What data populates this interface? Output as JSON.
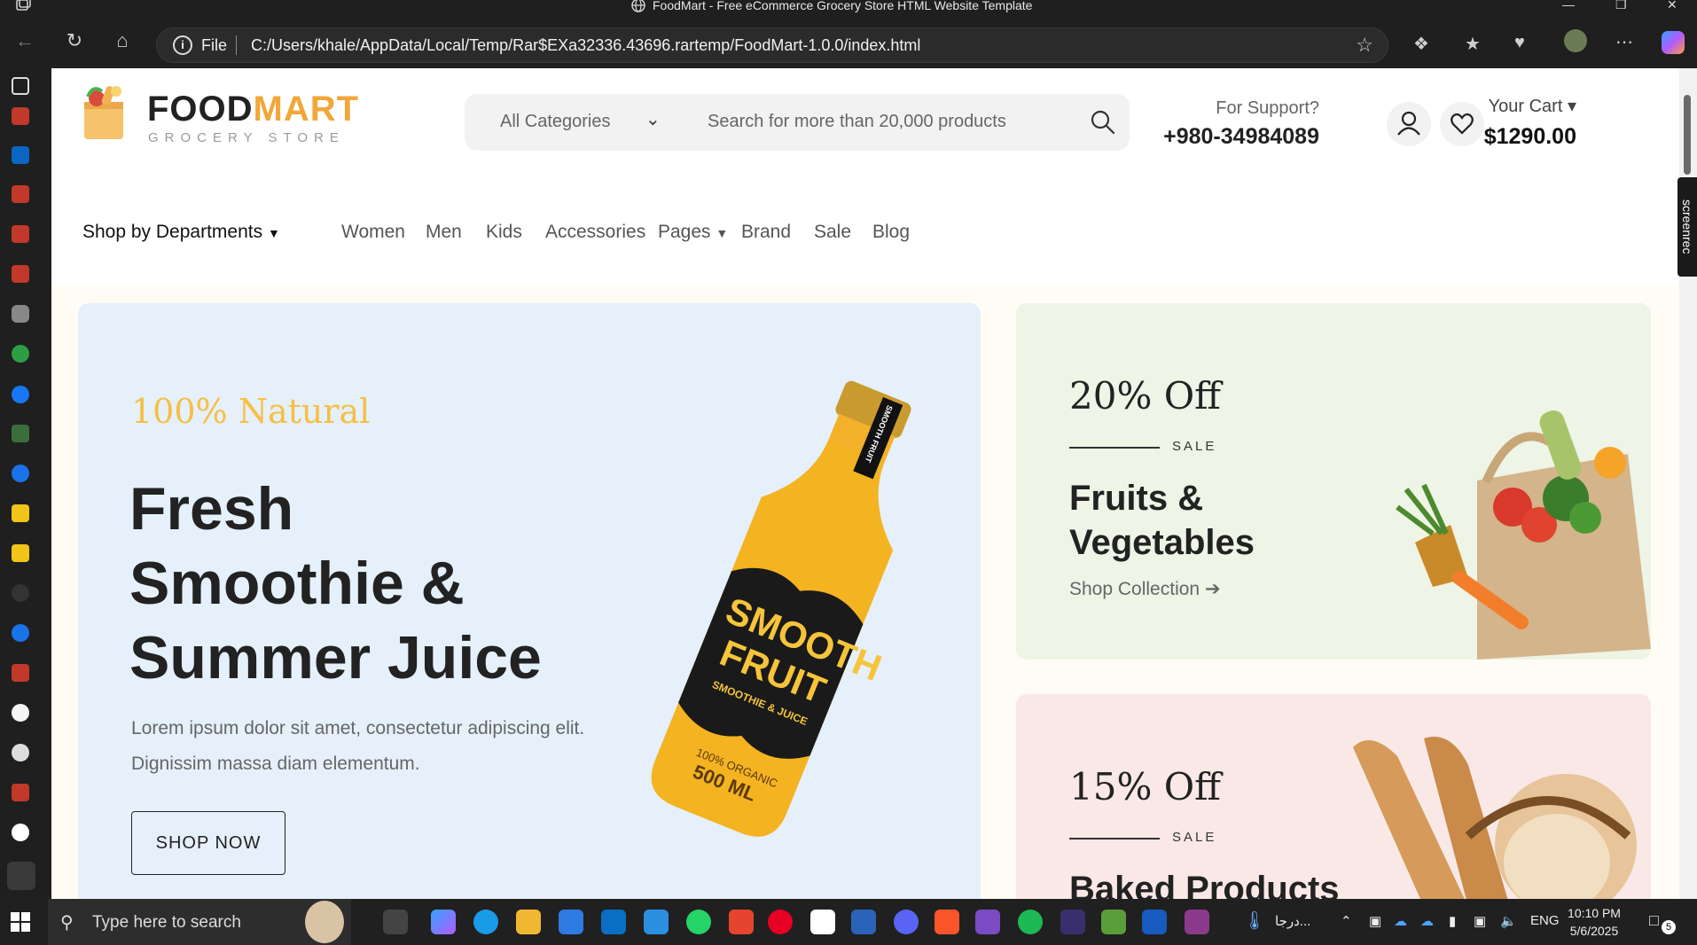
{
  "window": {
    "title": "FoodMart - Free eCommerce Grocery Store HTML Website Template"
  },
  "addressbar": {
    "scheme_label": "File",
    "url": "C:/Users/khale/AppData/Local/Temp/Rar$EXa32336.43696.rartemp/FoodMart-1.0.0/index.html"
  },
  "header": {
    "brand_part1": "FOOD",
    "brand_part2": "MART",
    "tagline": "GROCERY STORE",
    "category_select": "All Categories",
    "search_placeholder": "Search for more than 20,000 products",
    "support_label": "For Support?",
    "support_phone": "+980-34984089",
    "cart_label": "Your Cart",
    "cart_total": "$1290.00"
  },
  "nav": {
    "departments": "Shop by Departments",
    "items": [
      "Women",
      "Men",
      "Kids",
      "Accessories",
      "Pages",
      "Brand",
      "Sale",
      "Blog"
    ]
  },
  "banner": {
    "kicker": "100% Natural",
    "headline_line1": "Fresh",
    "headline_line2": "Smoothie &",
    "headline_line3": "Summer Juice",
    "description": "Lorem ipsum dolor sit amet, consectetur adipiscing elit. Dignissim massa diam elementum.",
    "button": "SHOP NOW",
    "bottle_label_top": "SMOOTH FRUIT",
    "bottle_label_main1": "SMOOTH",
    "bottle_label_main2": "FRUIT",
    "bottle_label_sub": "SMOOTHIE & JUICE",
    "bottle_label_organic": "100% ORGANIC",
    "bottle_label_volume": "500 ML"
  },
  "promo_cards": [
    {
      "discount": "20% Off",
      "tag": "SALE",
      "title": "Fruits & Vegetables",
      "link": "Shop Collection"
    },
    {
      "discount": "15% Off",
      "tag": "SALE",
      "title": "Baked Products"
    }
  ],
  "extension": {
    "label": "screenrec"
  },
  "taskbar": {
    "search_placeholder": "Type here to search",
    "weather_text": "درجا...",
    "language": "ENG",
    "time": "10:10 PM",
    "date": "5/6/2025",
    "notification_count": "5"
  },
  "colors": {
    "accent": "#f2a73b",
    "kicker": "#f6bf43",
    "banner_bg": "#e5f0fa",
    "card_green": "#eef4e6",
    "card_pink": "#f9e8e6"
  }
}
